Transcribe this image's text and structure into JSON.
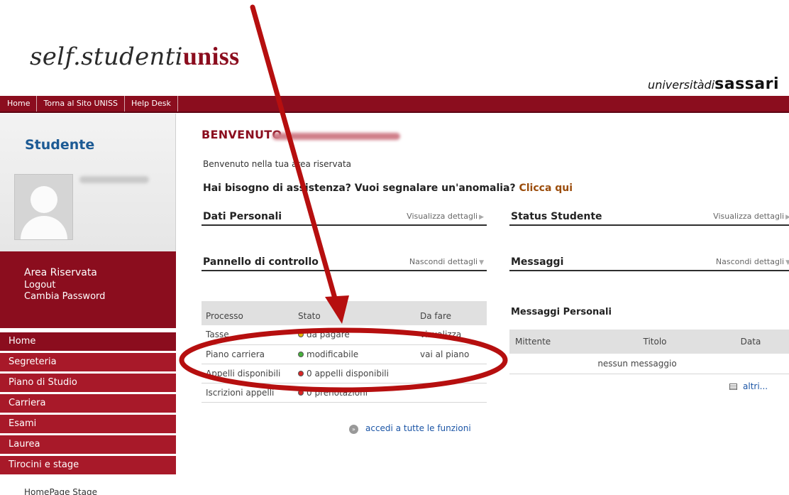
{
  "header": {
    "logo_prefix": "self.studenti",
    "logo_brand": "uniss",
    "university_prefix": "universitàdi",
    "university_name": "sassari"
  },
  "topnav": [
    "Home",
    "Torna al Sito UNISS",
    "Help Desk"
  ],
  "sidebar": {
    "title": "Studente",
    "area": {
      "title": "Area Riservata",
      "links": [
        "Logout",
        "Cambia Password"
      ]
    },
    "menu": [
      "Home",
      "Segreteria",
      "Piano di Studio",
      "Carriera",
      "Esami",
      "Laurea",
      "Tirocini e stage"
    ],
    "submenu_item": "HomePage Stage"
  },
  "main": {
    "welcome_title": "BENVENUTO",
    "welcome_subtitle": "Benvenuto nella tua area riservata",
    "help_text": "Hai bisogno di assistenza? Vuoi segnalare un'anomalia?",
    "help_link": "Clicca qui",
    "panels": {
      "personal": {
        "title": "Dati Personali",
        "action": "Visualizza dettagli"
      },
      "status": {
        "title": "Status Studente",
        "action": "Visualizza dettagli"
      },
      "control": {
        "title": "Pannello di controllo",
        "action": "Nascondi dettagli"
      },
      "messages": {
        "title": "Messaggi",
        "action": "Nascondi dettagli"
      }
    },
    "process_table": {
      "headers": [
        "Processo",
        "Stato",
        "Da fare"
      ],
      "rows": [
        {
          "process": "Tasse",
          "status": "da pagare",
          "status_color": "#e3b400",
          "action": "visualizza"
        },
        {
          "process": "Piano carriera",
          "status": "modificabile",
          "status_color": "#46b13b",
          "action": "vai al piano"
        },
        {
          "process": "Appelli disponibili",
          "status": "0 appelli disponibili",
          "status_color": "#d92525",
          "action": ""
        },
        {
          "process": "Iscrizioni appelli",
          "status": "0 prenotazioni",
          "status_color": "#d92525",
          "action": ""
        }
      ],
      "footer_link": "accedi a tutte le funzioni"
    },
    "personal_messages": {
      "title": "Messaggi Personali",
      "headers": [
        "Mittente",
        "Titolo",
        "Data"
      ],
      "empty": "nessun messaggio",
      "more_link": "altri..."
    }
  },
  "colors": {
    "brand": "#8b0d1e",
    "menu": "#a81929",
    "link": "#1b55a6",
    "annotation": "#b60f0f"
  }
}
